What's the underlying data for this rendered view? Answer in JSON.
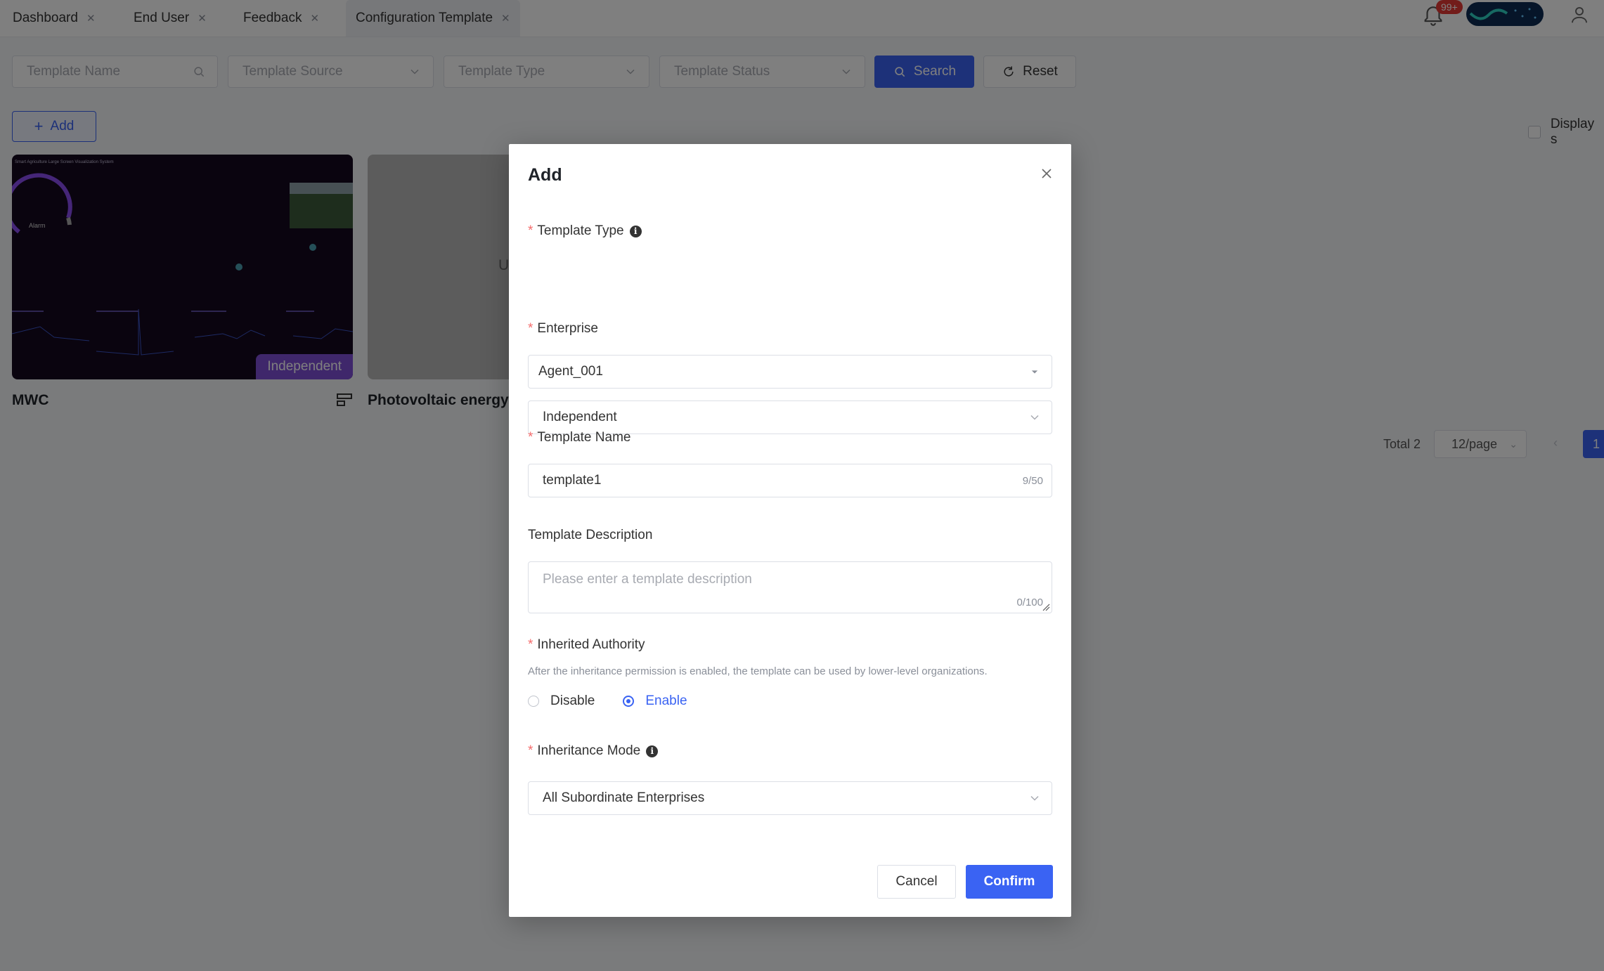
{
  "tabs": [
    {
      "label": "Dashboard"
    },
    {
      "label": "End User"
    },
    {
      "label": "Feedback"
    },
    {
      "label": "Configuration Template"
    }
  ],
  "header": {
    "notification_badge": "99+",
    "notification_icon": "bell-icon",
    "user_icon": "user-icon"
  },
  "filters": {
    "template_name_placeholder": "Template Name",
    "template_source_placeholder": "Template Source",
    "template_type_placeholder": "Template Type",
    "template_status_placeholder": "Template Status",
    "search_label": "Search",
    "reset_label": "Reset"
  },
  "toolbar": {
    "add_label": "Add",
    "display_toggle_label": "Display s"
  },
  "cards": [
    {
      "title": "MWC",
      "tag": "Independent",
      "thumb_title": "Smart Agriculture Large Screen Visualization System",
      "gauge_label": "Alarm"
    },
    {
      "title": "Photovoltaic energy",
      "thumb_partial_text": "U"
    }
  ],
  "pagination": {
    "total": "Total 2",
    "page_size": "12/page",
    "current_page": "1"
  },
  "modal": {
    "title": "Add",
    "template_type_label": "Template Type",
    "template_type_value": "Independent",
    "enterprise_label": "Enterprise",
    "enterprise_value": "Agent_001",
    "template_name_label": "Template Name",
    "template_name_value": "template1",
    "template_name_count": "9/50",
    "description_label": "Template Description",
    "description_placeholder": "Please enter a template description",
    "description_count": "0/100",
    "inherited_authority_label": "Inherited Authority",
    "inherited_authority_hint": "After the inheritance permission is enabled, the template can be used by lower-level organizations.",
    "radio_disable": "Disable",
    "radio_enable": "Enable",
    "inheritance_mode_label": "Inheritance Mode",
    "inheritance_mode_value": "All Subordinate Enterprises",
    "cancel_label": "Cancel",
    "confirm_label": "Confirm"
  },
  "colors": {
    "primary": "#3a63f3",
    "required": "#f56c6c",
    "tag": "#7f4fd6",
    "badge": "#e53935"
  }
}
